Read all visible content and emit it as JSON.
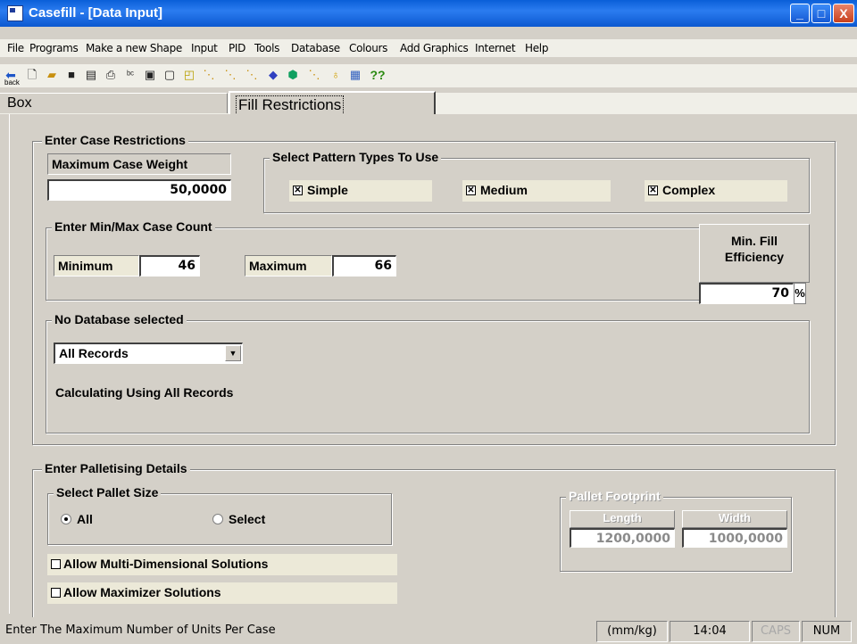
{
  "window": {
    "title": "Casefill - [Data Input]",
    "minimize": "_",
    "maximize": "□",
    "close": "X"
  },
  "menu": [
    "File",
    "Programs",
    "Make a new Shape",
    "Input",
    "PID",
    "Tools",
    "Database",
    "Colours",
    "Add Graphics",
    "Internet",
    "Help"
  ],
  "toolbar": {
    "back_label": "back",
    "icons": [
      "back-icon",
      "new-file-icon",
      "open-folder-icon",
      "save-icon",
      "calculator-icon",
      "print-icon",
      "spell-check-icon",
      "document-icon",
      "preview-icon",
      "shapes-icon",
      "pattern1-icon",
      "pattern2-icon",
      "pattern3-icon",
      "paint-icon",
      "cube-icon",
      "pattern4-icon",
      "bottle-icon",
      "calendar-icon",
      "help-icon"
    ],
    "help_label": "??"
  },
  "tabs": {
    "box": "Box",
    "fill": "Fill Restrictions"
  },
  "case_restrictions": {
    "title": "Enter Case Restrictions",
    "max_weight_label": "Maximum Case Weight",
    "max_weight_value": "50,0000",
    "pattern_title": "Select Pattern Types To Use",
    "patterns": [
      {
        "label": "Simple",
        "checked": true
      },
      {
        "label": "Medium",
        "checked": true
      },
      {
        "label": "Complex",
        "checked": true
      }
    ],
    "count_title": "Enter Min/Max Case Count",
    "min_label": "Minimum",
    "min_value": "46",
    "max_label": "Maximum",
    "max_value": "66",
    "efficiency_label_1": "Min. Fill",
    "efficiency_label_2": "Efficiency",
    "efficiency_value": "70",
    "efficiency_unit": "%",
    "db_title": "No Database selected",
    "db_select": "All Records",
    "db_status": "Calculating Using All Records"
  },
  "palletising": {
    "title": "Enter Palletising Details",
    "pallet_size_title": "Select Pallet Size",
    "radio_all": "All",
    "radio_select": "Select",
    "selected": "All",
    "multi_dim": "Allow Multi-Dimensional Solutions",
    "maximizer": "Allow Maximizer Solutions",
    "footprint_title": "Pallet Footprint",
    "length_label": "Length",
    "length_value": "1200,0000",
    "width_label": "Width",
    "width_value": "1000,0000"
  },
  "status": {
    "message": "Enter The Maximum Number of Units Per Case",
    "units": "(mm/kg)",
    "time": "14:04",
    "caps": "CAPS",
    "num": "NUM"
  }
}
